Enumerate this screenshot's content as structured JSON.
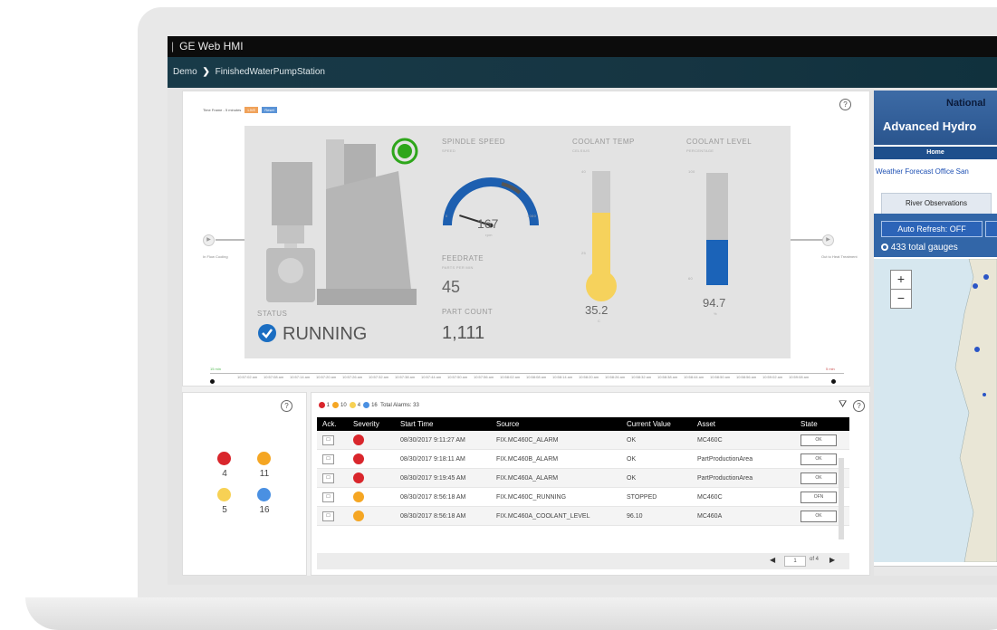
{
  "window": {
    "title": "GE Web HMI"
  },
  "breadcrumb": {
    "root": "Demo",
    "current": "FinishedWaterPumpStation"
  },
  "timeframe": {
    "label": "Time Frame - 5 minutes",
    "live": "LIVE",
    "reset": "Reset"
  },
  "process": {
    "input_label": "In Flow Cooling",
    "output_label": "Out to Heat Treatment"
  },
  "spindle": {
    "title": "SPINDLE SPEED",
    "subtitle": "SPEED",
    "value": "167",
    "unit": "rpm",
    "min": "0",
    "max": "1000",
    "fraction": 0.167
  },
  "feedrate": {
    "title": "FEEDRATE",
    "subtitle": "PARTS PER MIN",
    "value": "45"
  },
  "part_count": {
    "title": "PART COUNT",
    "value": "1,111"
  },
  "status": {
    "title": "STATUS",
    "value": "RUNNING"
  },
  "coolant_temp": {
    "title": "COOLANT TEMP",
    "subtitle": "CELSIUS",
    "value": "35.2",
    "unit": "C",
    "tick_top": "40",
    "tick_mid": "25",
    "fraction": 0.62
  },
  "coolant_level": {
    "title": "COOLANT LEVEL",
    "subtitle": "PERCENTAGE",
    "value": "94.7",
    "unit": "%",
    "tick_top": "100",
    "tick_bottom": "60",
    "fraction": 0.4
  },
  "timeline": {
    "start": "15 min",
    "ticks": [
      "10:57:02 am",
      "10:57:08 am",
      "10:57:14 am",
      "10:57:20 am",
      "10:57:26 am",
      "10:57:32 am",
      "10:57:38 am",
      "10:57:44 am",
      "10:57:50 am",
      "10:57:56 am",
      "10:58:02 am",
      "10:58:08 am",
      "10:58:14 am",
      "10:58:20 am",
      "10:58:26 am",
      "10:58:32 am",
      "10:58:38 am",
      "10:58:44 am",
      "10:58:50 am",
      "10:58:56 am",
      "10:59:02 am",
      "10:59:08 am"
    ],
    "end": "5 min"
  },
  "severity_summary": {
    "items": [
      {
        "icon": "critical-alarm-icon",
        "color": "#d9262c",
        "count": "4"
      },
      {
        "icon": "warning-alarm-icon",
        "color": "#f5a623",
        "count": "11"
      },
      {
        "icon": "caution-alarm-icon",
        "color": "#f7d154",
        "count": "5"
      },
      {
        "icon": "info-alarm-icon",
        "color": "#4a90e2",
        "count": "16"
      }
    ]
  },
  "alarm_summary": {
    "c1": "1",
    "c2": "10",
    "c3": "4",
    "c4": "16",
    "total": "Total Alarms: 33"
  },
  "alarm_table": {
    "headers": [
      "Ack.",
      "Severity",
      "Start Time",
      "Source",
      "Current Value",
      "Asset",
      "State"
    ],
    "rows": [
      {
        "ack": "☐",
        "severity": "critical",
        "start": "08/30/2017 9:11:27 AM",
        "source": "FIX.MC460C_ALARM",
        "value": "OK",
        "asset": "MC460C",
        "state": "OK"
      },
      {
        "ack": "☐",
        "severity": "critical",
        "start": "08/30/2017 9:18:11 AM",
        "source": "FIX.MC460B_ALARM",
        "value": "OK",
        "asset": "PartProductionArea",
        "state": "OK"
      },
      {
        "ack": "☐",
        "severity": "critical",
        "start": "08/30/2017 9:19:45 AM",
        "source": "FIX.MC460A_ALARM",
        "value": "OK",
        "asset": "PartProductionArea",
        "state": "OK"
      },
      {
        "ack": "☐",
        "severity": "warning",
        "start": "08/30/2017 8:56:18 AM",
        "source": "FIX.MC460C_RUNNING",
        "value": "STOPPED",
        "asset": "MC460C",
        "state": "OFN"
      },
      {
        "ack": "☐",
        "severity": "warning",
        "start": "08/30/2017 8:56:18 AM",
        "source": "FIX.MC460A_COOLANT_LEVEL",
        "value": "96.10",
        "asset": "MC460A",
        "state": "OK"
      }
    ],
    "pager": {
      "page": "1",
      "of": "of 4"
    }
  },
  "right_panel": {
    "title1": "National",
    "title2": "Advanced Hydro",
    "home": "Home",
    "link": "Weather Forecast Office San",
    "tab": "River Observations",
    "auto_refresh": "Auto Refresh: OFF",
    "gauges": "433 total gauges",
    "zoom_in": "+",
    "zoom_out": "−"
  },
  "colors": {
    "running": "#1b6ec2",
    "gauge_arc": "#1d5fb0",
    "thermo_fill": "#f6d25c",
    "level_fill": "#1b63b8",
    "green_status": "#2ea61b"
  }
}
